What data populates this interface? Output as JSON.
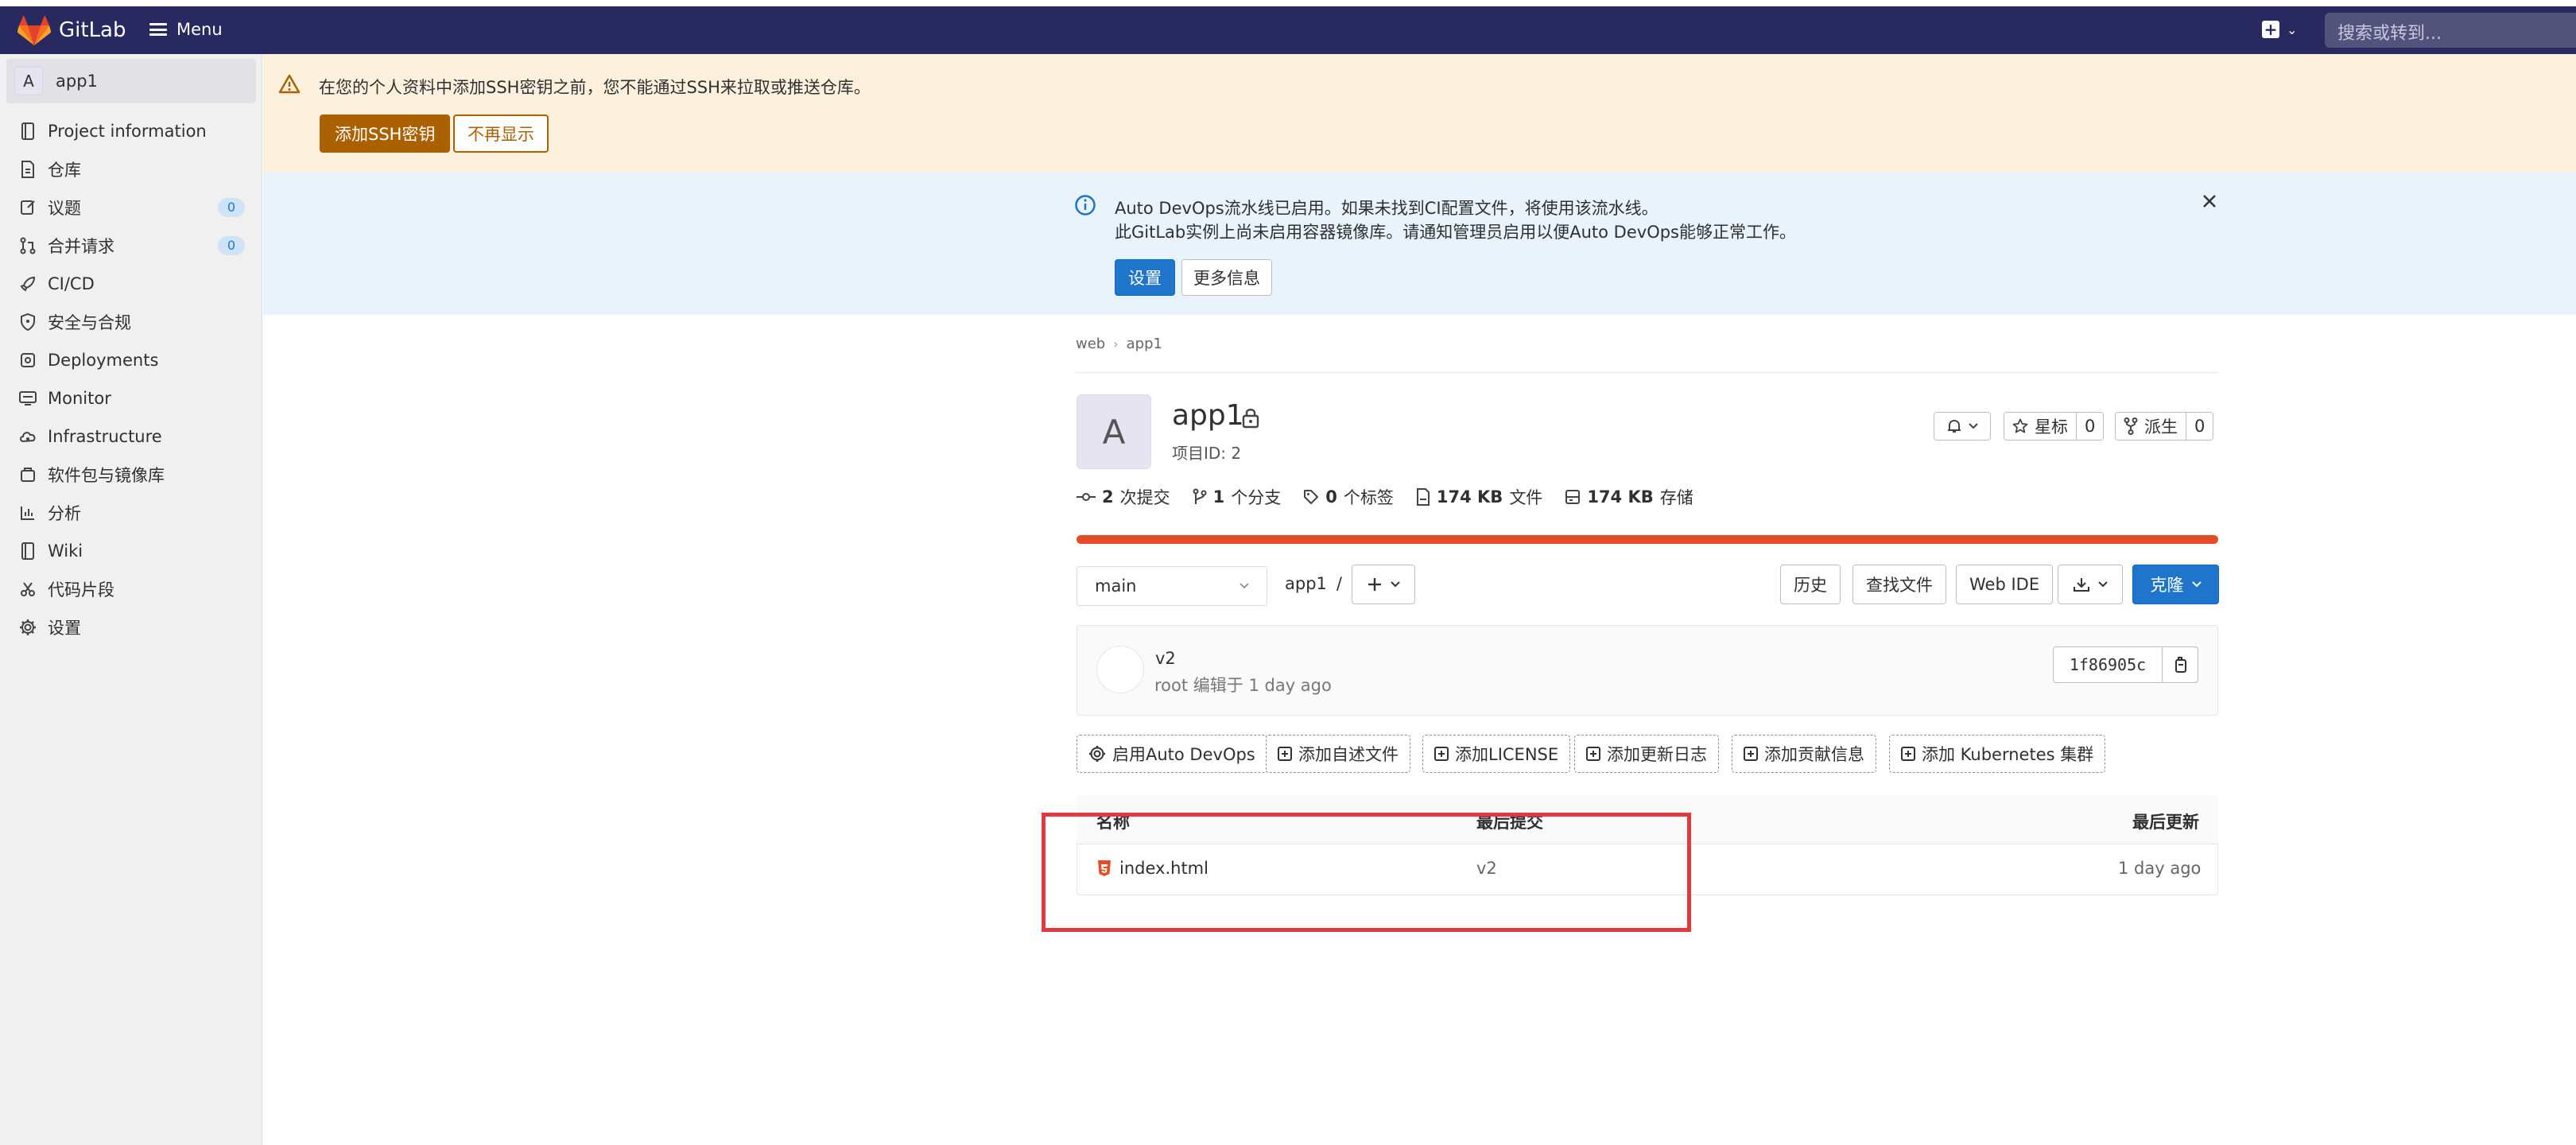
{
  "header": {
    "brand": "GitLab",
    "menu_label": "Menu",
    "search_placeholder": "搜索或转到..."
  },
  "sidebar": {
    "project_avatar": "A",
    "project_name": "app1",
    "items": [
      {
        "label": "Project information",
        "icon": "info-book-icon"
      },
      {
        "label": "仓库",
        "icon": "doc-icon"
      },
      {
        "label": "议题",
        "icon": "issues-icon",
        "count": "0"
      },
      {
        "label": "合并请求",
        "icon": "merge-request-icon",
        "count": "0"
      },
      {
        "label": "CI/CD",
        "icon": "rocket-icon"
      },
      {
        "label": "安全与合规",
        "icon": "shield-icon"
      },
      {
        "label": "Deployments",
        "icon": "deployments-icon"
      },
      {
        "label": "Monitor",
        "icon": "monitor-icon"
      },
      {
        "label": "Infrastructure",
        "icon": "cloud-icon"
      },
      {
        "label": "软件包与镜像库",
        "icon": "package-icon"
      },
      {
        "label": "分析",
        "icon": "chart-icon"
      },
      {
        "label": "Wiki",
        "icon": "book-icon"
      },
      {
        "label": "代码片段",
        "icon": "scissors-icon"
      },
      {
        "label": "设置",
        "icon": "gear-icon"
      }
    ]
  },
  "ssh_alert": {
    "text": "在您的个人资料中添加SSH密钥之前，您不能通过SSH来拉取或推送仓库。",
    "add_button": "添加SSH密钥",
    "dismiss_button": "不再显示"
  },
  "devops_alert": {
    "line1": "Auto DevOps流水线已启用。如果未找到CI配置文件，将使用该流水线。",
    "line2": "此GitLab实例上尚未启用容器镜像库。请通知管理员启用以便Auto DevOps能够正常工作。",
    "settings_button": "设置",
    "more_button": "更多信息"
  },
  "breadcrumb": [
    "web",
    "app1"
  ],
  "project": {
    "avatar": "A",
    "name": "app1",
    "id_label": "项目ID: 2",
    "star_label": "星标",
    "star_count": "0",
    "fork_label": "派生",
    "fork_count": "0"
  },
  "stats": [
    {
      "value": "2",
      "label": "次提交",
      "icon": "commit-icon"
    },
    {
      "value": "1",
      "label": "个分支",
      "icon": "branch-icon"
    },
    {
      "value": "0",
      "label": "个标签",
      "icon": "tag-icon"
    },
    {
      "value": "174 KB",
      "label": "文件",
      "icon": "file-icon"
    },
    {
      "value": "174 KB",
      "label": "存储",
      "icon": "storage-icon"
    }
  ],
  "language_color": "#e34c26",
  "repo_toolbar": {
    "branch": "main",
    "path": "app1",
    "path_sep": "/",
    "history": "历史",
    "find_file": "查找文件",
    "web_ide": "Web IDE",
    "clone": "克隆"
  },
  "last_commit": {
    "title": "v2",
    "meta": "root 编辑于 1 day ago",
    "sha": "1f86905c"
  },
  "suggestions": [
    "启用Auto DevOps",
    "添加自述文件",
    "添加LICENSE",
    "添加更新日志",
    "添加贡献信息",
    "添加 Kubernetes 集群"
  ],
  "file_table": {
    "headers": [
      "名称",
      "最后提交",
      "最后更新"
    ],
    "rows": [
      {
        "name": "index.html",
        "commit": "v2",
        "updated": "1 day ago"
      }
    ]
  },
  "colors": {
    "topbar": "#292961",
    "primary": "#1f75cb",
    "warning_btn": "#ab6100",
    "annotation": "#e03a3e"
  }
}
